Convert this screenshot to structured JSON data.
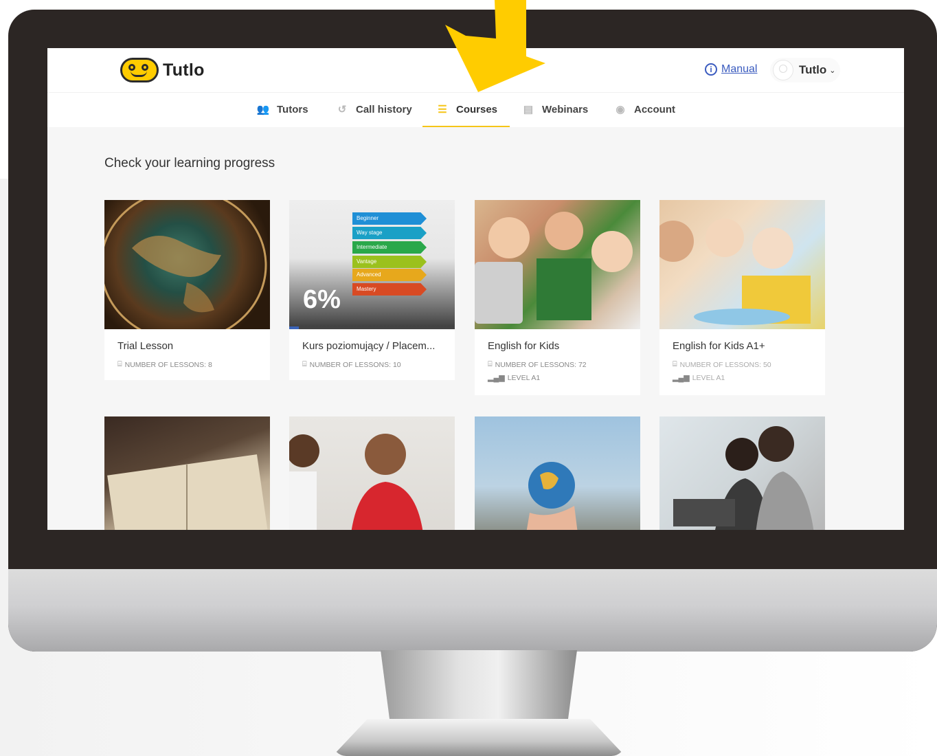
{
  "app": {
    "name": "Tutlo"
  },
  "header": {
    "manual_label": "Manual",
    "user_name": "Tutlo"
  },
  "nav": {
    "items": [
      {
        "label": "Tutors",
        "icon": "people-icon"
      },
      {
        "label": "Call history",
        "icon": "history-icon"
      },
      {
        "label": "Courses",
        "icon": "list-icon",
        "active": true
      },
      {
        "label": "Webinars",
        "icon": "webinar-icon"
      },
      {
        "label": "Account",
        "icon": "account-icon"
      }
    ]
  },
  "page": {
    "heading": "Check your learning progress"
  },
  "courses": [
    {
      "title": "Trial Lesson",
      "lessons": "NUMBER OF LESSONS: 8"
    },
    {
      "title": "Kurs poziomujący / Placem...",
      "lessons": "NUMBER OF LESSONS: 10",
      "progress_label": "6%",
      "progress": 0.06,
      "levels": [
        "Beginner",
        "Way stage",
        "Intermediate",
        "Vantage",
        "Advanced",
        "Mastery"
      ]
    },
    {
      "title": "English for Kids",
      "lessons": "NUMBER OF LESSONS: 72",
      "level": "LEVEL A1"
    },
    {
      "title": "English for Kids A1+",
      "lessons": "NUMBER OF LESSONS: 50",
      "level": "LEVEL A1"
    }
  ],
  "colors": {
    "accent": "#f5c518",
    "link": "#3a5bbf",
    "arrow": "#ffcc00"
  }
}
